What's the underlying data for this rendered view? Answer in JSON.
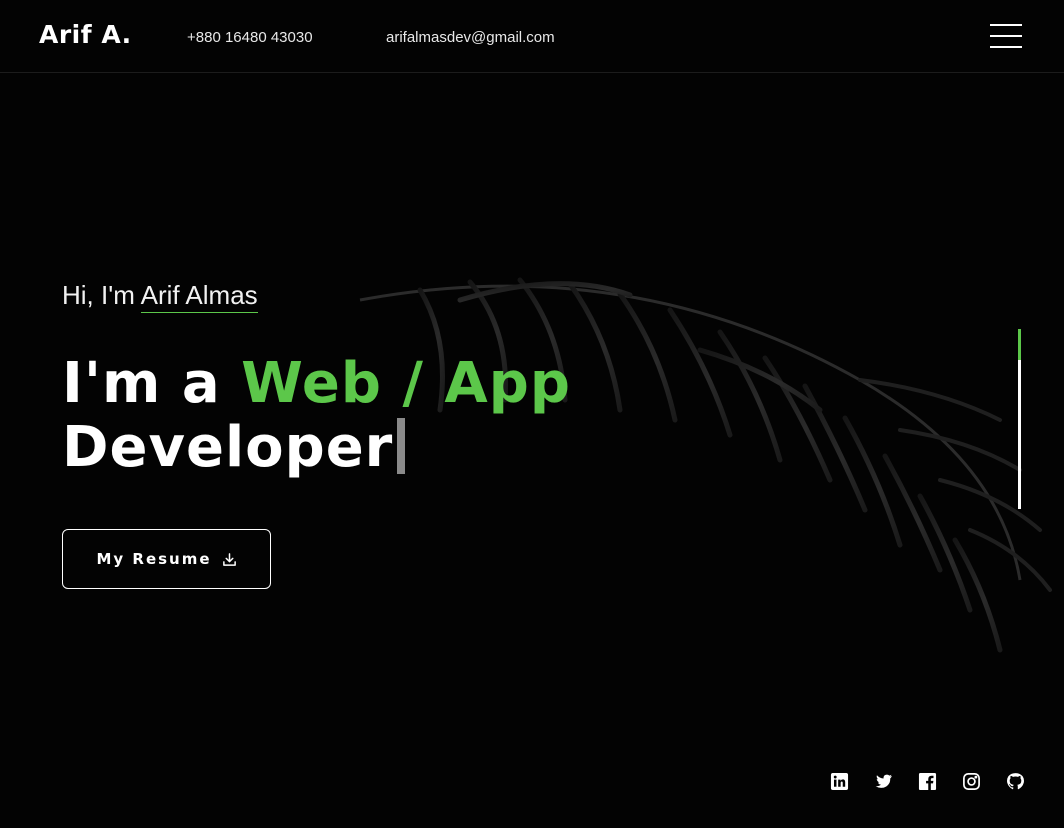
{
  "header": {
    "logo": "Arif A.",
    "phone": "+880 16480 43030",
    "email": "arifalmasdev@gmail.com",
    "menu_icon": "hamburger-icon"
  },
  "hero": {
    "greeting_prefix": "Hi, I'm ",
    "greeting_name": "Arif Almas",
    "headline_prefix": "I'm a ",
    "headline_accent": "Web / App",
    "headline_suffix": "Developer",
    "resume_label": "My Resume",
    "resume_icon": "download-icon"
  },
  "scroll_indicator": {
    "progress": 0.17
  },
  "socials": [
    {
      "icon": "linkedin-icon"
    },
    {
      "icon": "twitter-icon"
    },
    {
      "icon": "facebook-icon"
    },
    {
      "icon": "instagram-icon"
    },
    {
      "icon": "github-icon"
    }
  ],
  "colors": {
    "background": "#030303",
    "accent": "#5cc74a",
    "text": "#ffffff",
    "cursor": "#8a8a8a"
  }
}
